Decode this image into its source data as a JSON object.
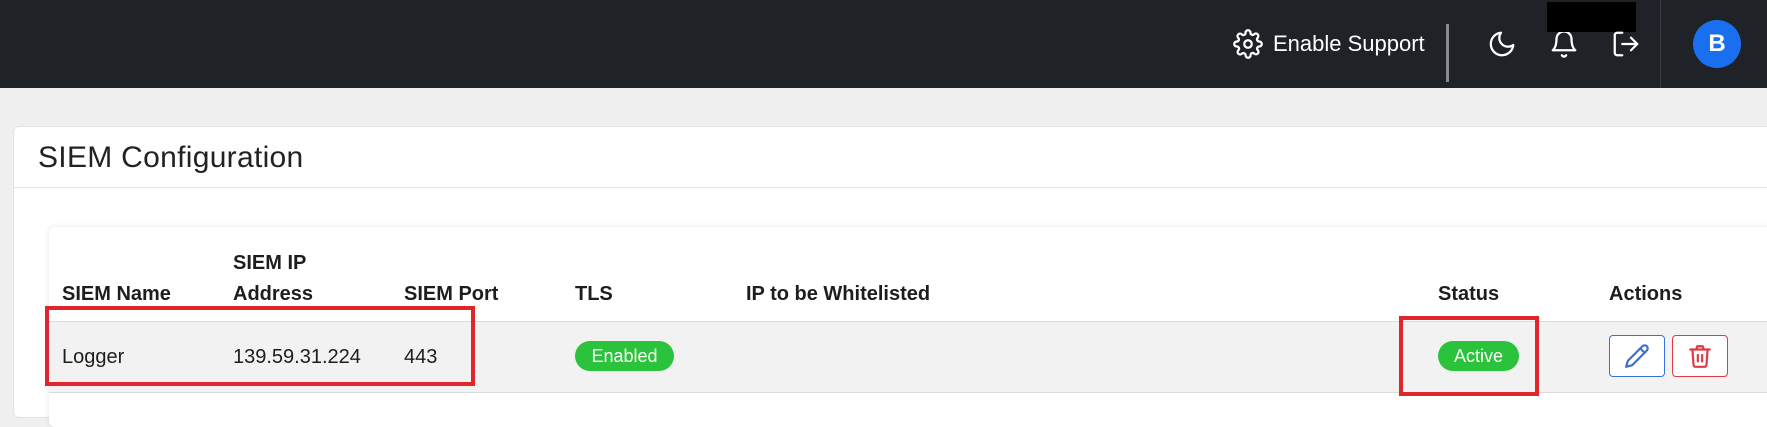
{
  "header": {
    "support_label": "Enable Support",
    "avatar_initial": "B",
    "icons": [
      "gear-icon",
      "moon-icon",
      "bell-icon",
      "logout-icon"
    ]
  },
  "page": {
    "title": "SIEM Configuration"
  },
  "table": {
    "columns": {
      "siem_name": "SIEM Name",
      "siem_ip_line1": "SIEM IP",
      "siem_ip_line2": "Address",
      "siem_port": "SIEM Port",
      "tls": "TLS",
      "ip_whitelist": "IP to be Whitelisted",
      "status": "Status",
      "actions": "Actions"
    },
    "rows": [
      {
        "siem_name": "Logger",
        "siem_ip": "139.59.31.224",
        "siem_port": "443",
        "tls": "Enabled",
        "ip_whitelist": "",
        "status": "Active",
        "actions": [
          "pencil-icon",
          "trash-icon"
        ]
      }
    ]
  },
  "colors": {
    "topbar_bg": "#1f2327",
    "accent_blue": "#1a6ff0",
    "badge_green": "#2bc23c",
    "highlight_red": "#e0252b",
    "danger_red": "#e23a44"
  }
}
